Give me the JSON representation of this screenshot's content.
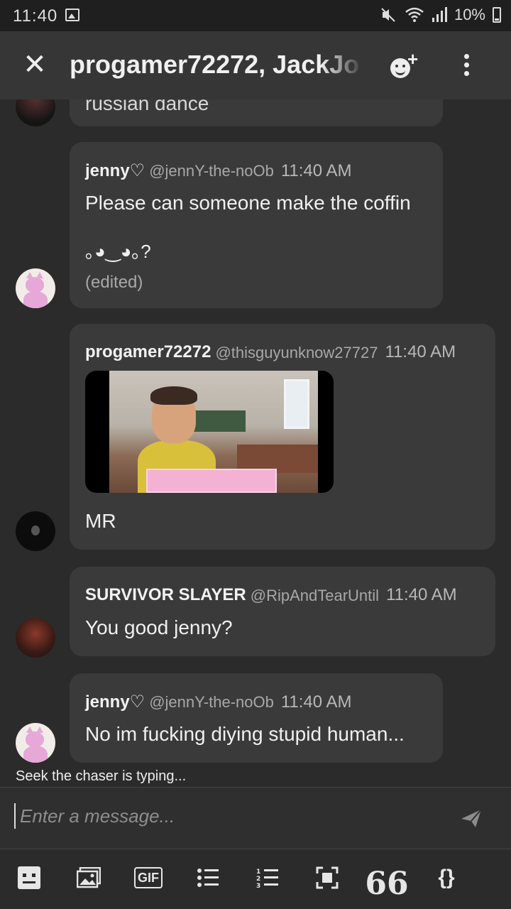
{
  "status_bar": {
    "time": "11:40",
    "battery": "10%"
  },
  "header": {
    "title": "progamer72272, JackJo"
  },
  "messages": [
    {
      "partial_text": "russian dance"
    },
    {
      "author": "jenny♡",
      "handle": "@jennY-the-noOb",
      "time": "11:40 AM",
      "text": "Please can someone make the coffin",
      "text2": "｡◕‿◕｡?",
      "edited": "(edited)"
    },
    {
      "author": "progamer72272",
      "handle": "@thisguyunknow27727",
      "time": "11:40 AM",
      "text": "MR"
    },
    {
      "author": "SURVIVOR SLAYER",
      "handle": "@RipAndTearUntil",
      "time": "11:40 AM",
      "text": "You good jenny?"
    },
    {
      "author": "jenny♡",
      "handle": "@jennY-the-noOb",
      "time": "11:40 AM",
      "text": "No im fucking diying stupid human..."
    }
  ],
  "typing_indicator": "Seek the chaser is typing...",
  "composer": {
    "placeholder": "Enter a message..."
  },
  "toolbar": {
    "gif_label": "GIF",
    "quote_label": "66",
    "code_label": "{}"
  },
  "icons": [
    "close-icon",
    "add-member-icon",
    "more-vert-icon",
    "send-icon",
    "emoji-icon",
    "image-icon",
    "gif-icon",
    "bullet-list-icon",
    "numbered-list-icon",
    "spoiler-icon",
    "quote-icon",
    "code-icon"
  ]
}
